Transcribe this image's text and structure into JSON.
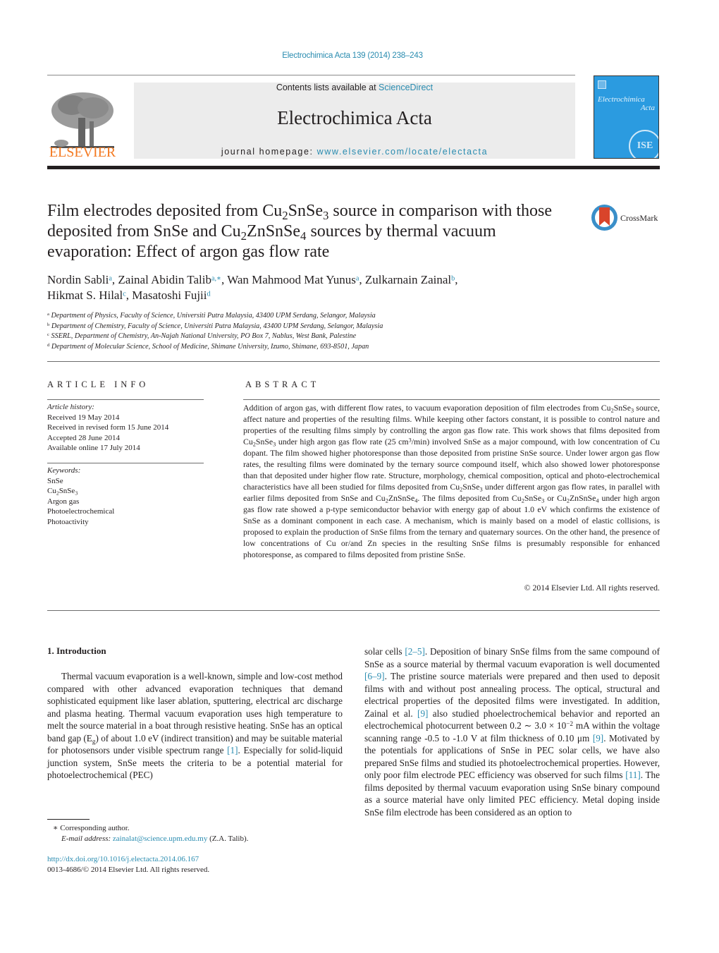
{
  "header": {
    "journal_ref": "Electrochimica Acta 139 (2014) 238–243",
    "contents_prefix": "Contents lists available at ",
    "contents_link": "ScienceDirect",
    "journal_name": "Electrochimica Acta",
    "homepage_prefix": "journal homepage: ",
    "homepage_link": "www.elsevier.com/locate/electacta",
    "publisher_logo_text": "ELSEVIER",
    "cover": {
      "title_line1": "Electrochimica",
      "title_line2": "Acta",
      "badge": "ISE"
    },
    "crossmark_label": "CrossMark",
    "colors": {
      "link": "#2a8cb0",
      "elsevier_orange": "#f47920",
      "cover_blue": "#2b9be0",
      "masthead_gray": "#ececec"
    }
  },
  "article": {
    "title": {
      "p1": "Film electrodes deposited from Cu",
      "s1": "2",
      "p2": "SnSe",
      "s2": "3",
      "p3": " source in comparison with those deposited from SnSe and Cu",
      "s3": "2",
      "p4": "ZnSnSe",
      "s4": "4",
      "p5": " sources by thermal vacuum evaporation: Effect of argon gas flow rate"
    },
    "authors": [
      {
        "name": "Nordin Sabli",
        "aff": "a",
        "sep": ", "
      },
      {
        "name": "Zainal Abidin Talib",
        "aff": "a,∗",
        "sep": ", "
      },
      {
        "name": "Wan Mahmood Mat Yunus",
        "aff": "a",
        "sep": ", "
      },
      {
        "name": "Zulkarnain Zainal",
        "aff": "b",
        "sep": ","
      },
      {
        "name": "Hikmat S. Hilal",
        "aff": "c",
        "sep": ", "
      },
      {
        "name": "Masatoshi Fujii",
        "aff": "d",
        "sep": ""
      }
    ],
    "affiliations": [
      {
        "key": "a",
        "text": "Department of Physics, Faculty of Science, Universiti Putra Malaysia, 43400 UPM Serdang, Selangor, Malaysia"
      },
      {
        "key": "b",
        "text": "Department of Chemistry, Faculty of Science, Universiti Putra Malaysia, 43400 UPM Serdang, Selangor, Malaysia"
      },
      {
        "key": "c",
        "text": "SSERL, Department of Chemistry, An-Najah National University, PO Box 7, Nablus, West Bank, Palestine"
      },
      {
        "key": "d",
        "text": "Department of Molecular Science, School of Medicine, Shimane University, Izumo, Shimane, 693-8501, Japan"
      }
    ]
  },
  "article_info": {
    "heading": "ARTICLE INFO",
    "history_label": "Article history:",
    "history": [
      "Received 19 May 2014",
      "Received in revised form 15 June 2014",
      "Accepted 28 June 2014",
      "Available online 17 July 2014"
    ],
    "keywords_label": "Keywords:",
    "keywords": {
      "k1": "SnSe",
      "k2_a": "Cu",
      "k2_s1": "2",
      "k2_b": "SnSe",
      "k2_s2": "3",
      "k3": "Argon gas",
      "k4": "Photoelectrochemical",
      "k5": "Photoactivity"
    }
  },
  "abstract": {
    "heading": "ABSTRACT",
    "t1": "Addition of argon gas, with different flow rates, to vacuum evaporation deposition of film electrodes from Cu",
    "t2": "SnSe",
    "t3": " source, affect nature and properties of the resulting films. While keeping other factors constant, it is possible to control nature and properties of the resulting films simply by controlling the argon gas flow rate. This work shows that films deposited from Cu",
    "t4": "SnSe",
    "t5": " under high argon gas flow rate (25 cm",
    "t6": "/min) involved SnSe as a major compound, with low concentration of Cu dopant. The film showed higher photoresponse than those deposited from pristine SnSe source. Under lower argon gas flow rates, the resulting films were dominated by the ternary source compound itself, which also showed lower photoresponse than that deposited under higher flow rate. Structure, morphology, chemical composition, optical and photo-electrochemical characteristics have all been studied for films deposited from Cu",
    "t7": "SnSe",
    "t8": " under different argon gas flow rates, in parallel with earlier films deposited from SnSe and Cu",
    "t9": "ZnSnSe",
    "t10": ". The films deposited from Cu",
    "t11": "SnSe",
    "t12": " or Cu",
    "t13": "ZnSnSe",
    "t14": " under high argon gas flow rate showed a p-type semiconductor behavior with energy gap of about 1.0 eV which confirms the existence of SnSe as a dominant component in each case. A mechanism, which is mainly based on a model of elastic collisions, is proposed to explain the production of SnSe films from the ternary and quaternary sources. On the other hand, the presence of low concentrations of Cu or/and Zn species in the resulting SnSe films is presumably responsible for enhanced photoresponse, as compared to films deposited from pristine SnSe.",
    "sub2": "2",
    "sub3": "3",
    "sub4": "4",
    "sup3": "3",
    "copyright": "© 2014 Elsevier Ltd. All rights reserved."
  },
  "intro": {
    "heading": "1.  Introduction",
    "c1a": "Thermal vacuum evaporation is a well-known, simple and low-cost method compared with other advanced evaporation techniques that demand sophisticated equipment like laser ablation, sputtering, electrical arc discharge and plasma heating. Thermal vacuum evaporation uses high temperature to melt the source material in a boat through resistive heating. SnSe has an optical band gap (E",
    "c1b": "g",
    "c1c": ") of about 1.0 eV (indirect transition) and may be suitable material for photosensors under visible spectrum range ",
    "ref1": "[1]",
    "c1d": ". Especially for solid-liquid junction system, SnSe meets the criteria to be a potential material for photoelectrochemical (PEC)",
    "c2a": "solar cells ",
    "ref2": "[2–5]",
    "c2b": ". Deposition of binary SnSe films from the same compound of SnSe as a source material by thermal vacuum evaporation is well documented ",
    "ref3": "[6–9]",
    "c2c": ". The pristine source materials were prepared and then used to deposit films with and without post annealing process. The optical, structural and electrical properties of the deposited films were investigated. In addition, Zainal et al. ",
    "ref4": "[9]",
    "c2d": " also studied phoelectrochemical behavior and reported an electrochemical photocurrent between 0.2 ∼ 3.0 × 10",
    "c2sup": "−2",
    "c2e": " mA within the voltage scanning range -0.5 to -1.0 V at film thickness of 0.10 μm ",
    "ref5": "[9]",
    "c2f": ". Motivated by the potentials for applications of SnSe in PEC solar cells, we have also prepared SnSe films and studied its photoelectrochemical properties. However, only poor film electrode PEC efficiency was observed for such films ",
    "ref6": "[11]",
    "c2g": ". The films deposited by thermal vacuum evaporation using SnSe binary compound as a source material have only limited PEC efficiency. Metal doping inside SnSe film electrode has been considered as an option to"
  },
  "footer": {
    "corresponding": "∗  Corresponding author.",
    "email_label": "E-mail address: ",
    "email": "zainalat@science.upm.edu.my",
    "email_suffix": " (Z.A. Talib).",
    "doi": "http://dx.doi.org/10.1016/j.electacta.2014.06.167",
    "issn_line": "0013-4686/© 2014 Elsevier Ltd. All rights reserved."
  }
}
